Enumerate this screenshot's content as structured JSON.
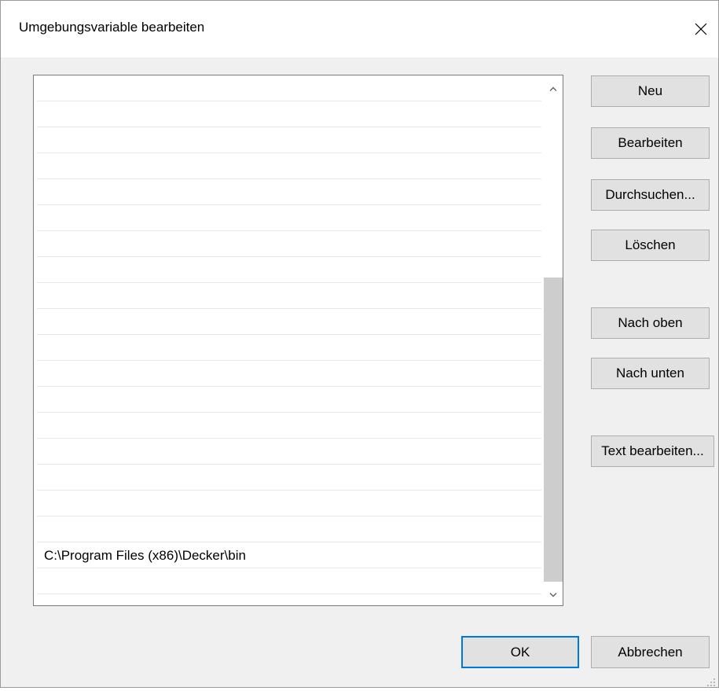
{
  "window": {
    "title": "Umgebungsvariable bearbeiten"
  },
  "list": {
    "items": [
      "",
      "",
      "",
      "",
      "",
      "",
      "",
      "",
      "",
      "",
      "",
      "",
      "",
      "",
      "",
      "",
      "",
      "",
      "C:\\Program Files (x86)\\Decker\\bin",
      "",
      ""
    ]
  },
  "scrollbar": {
    "thumb_start": 0.37,
    "thumb_end": 1.0
  },
  "buttons": {
    "new": "Neu",
    "edit": "Bearbeiten",
    "browse": "Durchsuchen...",
    "delete": "Löschen",
    "move_up": "Nach oben",
    "move_down": "Nach unten",
    "edit_text": "Text bearbeiten...",
    "ok": "OK",
    "cancel": "Abbrechen"
  },
  "icons": {
    "close": "close-icon",
    "scroll_up": "chevron-up-icon",
    "scroll_down": "chevron-down-icon",
    "resize": "resize-grip-icon"
  },
  "colors": {
    "accent": "#0078d7",
    "button_face": "#e1e1e1",
    "scroll_thumb": "#cdcdcd"
  }
}
